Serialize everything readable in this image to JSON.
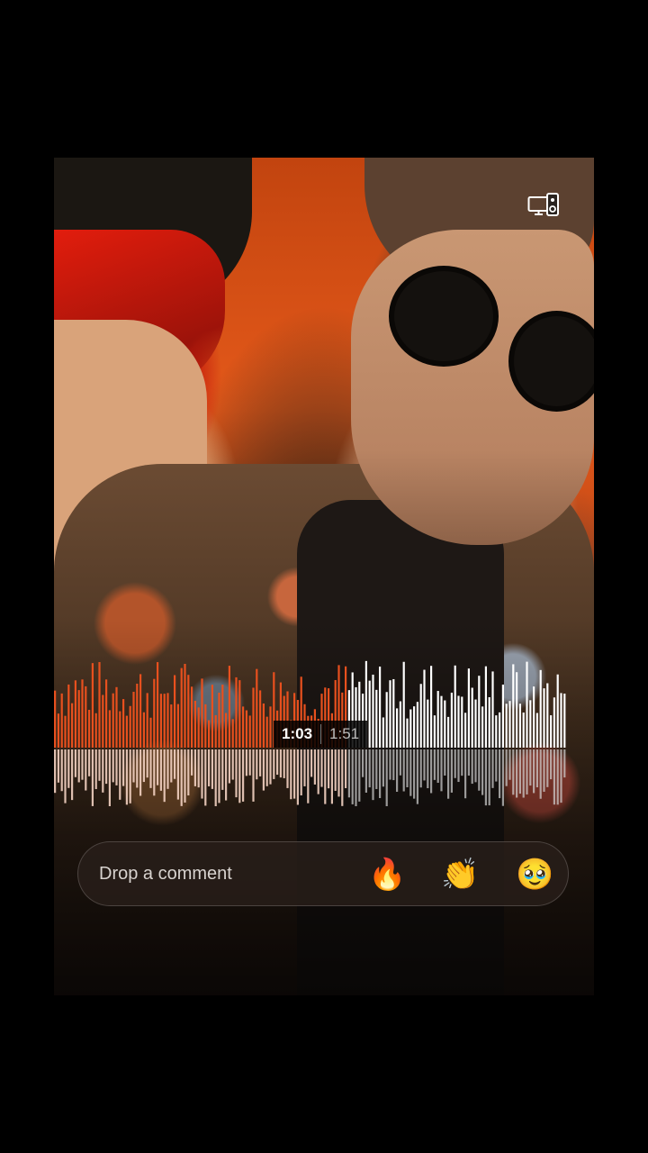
{
  "player": {
    "current_time": "1:03",
    "total_time": "1:51",
    "progress": 0.5676
  },
  "comment": {
    "placeholder": "Drop a comment"
  },
  "reactions": [
    {
      "emoji": "🔥",
      "name": "fire"
    },
    {
      "emoji": "👏",
      "name": "clapping-hands"
    },
    {
      "emoji": "🥹",
      "name": "face-holding-back-tears"
    }
  ],
  "icons": {
    "cast": "cast-to-device-icon"
  },
  "colors": {
    "played": "#e8501e",
    "unplayed": "#ffffff",
    "background": "#000000"
  }
}
